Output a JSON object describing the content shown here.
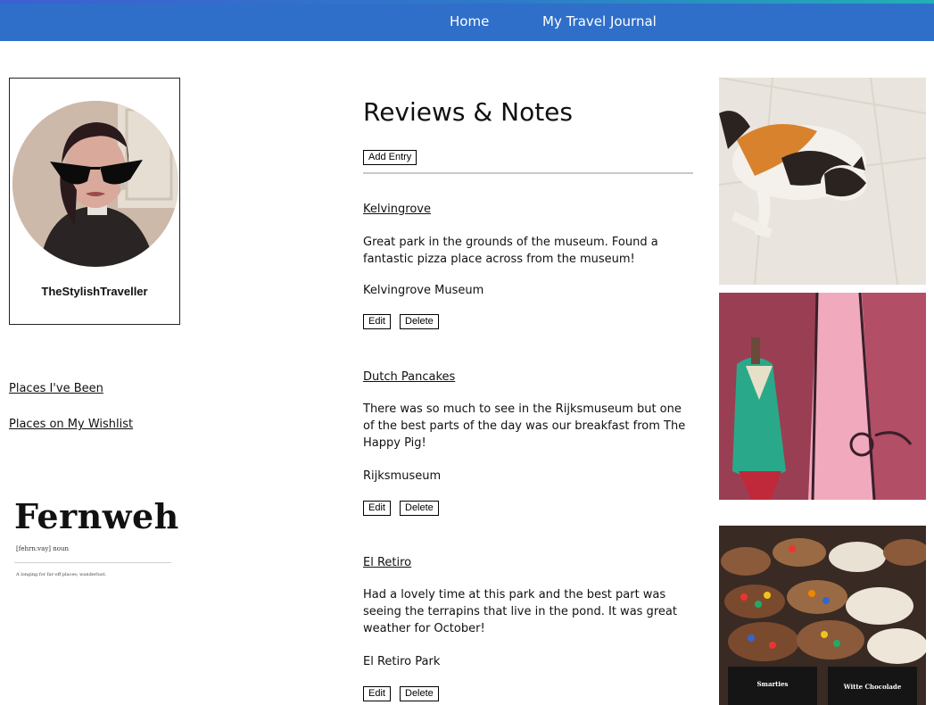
{
  "nav": {
    "home": "Home",
    "journal": "My Travel Journal"
  },
  "profile": {
    "username": "TheStylishTraveller"
  },
  "sidebar": {
    "links": [
      "Places I've Been",
      "Places on My Wishlist"
    ]
  },
  "fernweh": {
    "title": "Fernweh",
    "phonetic": "[fehrn:vay] noun",
    "definition": "A longing for far-off places; wanderlust."
  },
  "main": {
    "heading": "Reviews & Notes",
    "add_entry": "Add Entry",
    "edit_label": "Edit",
    "delete_label": "Delete",
    "entries": [
      {
        "title": "Kelvingrove",
        "text": "Great park in the grounds of the museum. Found a fantastic pizza place across from the museum!",
        "place": "Kelvingrove Museum"
      },
      {
        "title": "Dutch Pancakes",
        "text": "There was so much to see in the Rijksmuseum but one of the best parts of the day was our breakfast from The Happy Pig!",
        "place": "Rijksmuseum"
      },
      {
        "title": "El Retiro",
        "text": "Had a lovely time at this park and the best part was seeing the terrapins that live in the pond. It was great weather for October!",
        "place": "El Retiro Park"
      }
    ]
  },
  "photos": {
    "cookies_label_left": "Smarties",
    "cookies_label_right": "Witte Chocolade"
  },
  "colors": {
    "nav_bg": "#2f6fc9",
    "text": "#111111"
  }
}
